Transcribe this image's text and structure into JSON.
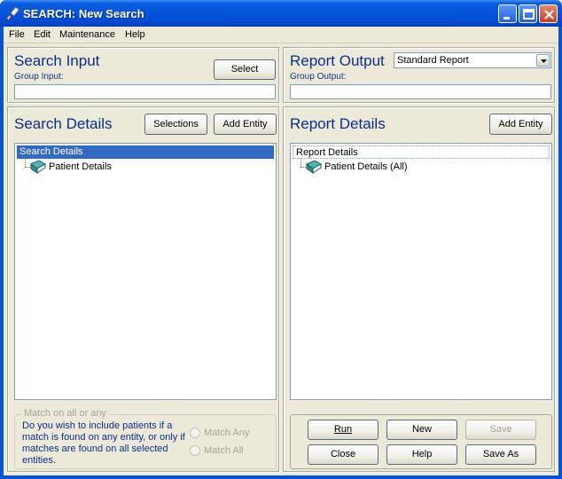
{
  "window": {
    "title": "SEARCH: New Search"
  },
  "menu": [
    "File",
    "Edit",
    "Maintenance",
    "Help"
  ],
  "search_input": {
    "heading": "Search Input",
    "group_label": "Group Input:",
    "group_value": "",
    "select_button": "Select"
  },
  "report_output": {
    "heading": "Report Output",
    "dropdown_value": "Standard Report",
    "group_label": "Group Output:",
    "group_value": ""
  },
  "search_details": {
    "heading": "Search Details",
    "selections_button": "Selections",
    "add_entity_button": "Add Entity",
    "tree_root": "Search Details",
    "tree_child": "Patient Details"
  },
  "report_details": {
    "heading": "Report Details",
    "add_entity_button": "Add Entity",
    "tree_root": "Report Details",
    "tree_child": "Patient Details (All)"
  },
  "match": {
    "title": "Match on all or any",
    "description": "Do you wish to include patients if a match is found on any entity, or only if matches are found on all selected entities.",
    "options": [
      "Match Any",
      "Match All"
    ]
  },
  "actions": {
    "run": "Run",
    "new": "New",
    "save": "Save",
    "close": "Close",
    "help": "Help",
    "save_as": "Save As"
  },
  "colors": {
    "heading": "#0b2f8f",
    "titlebar": "#0453dc",
    "selection": "#316ac5"
  }
}
